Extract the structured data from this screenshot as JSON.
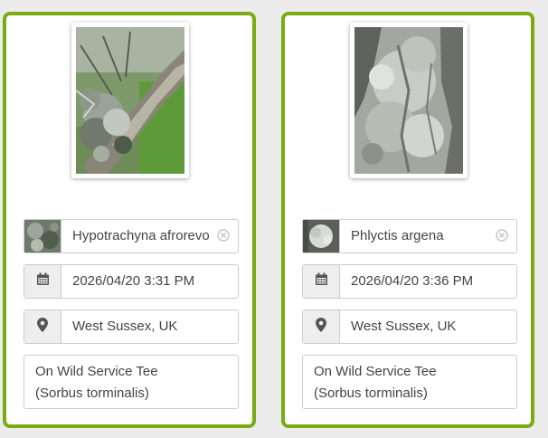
{
  "colors": {
    "card_border": "#7aab12",
    "page_background": "#ececec",
    "field_border": "#cccccc",
    "addon_background": "#eeeeee"
  },
  "observations": [
    {
      "species": "Hypotrachyna afrorevo",
      "datetime": "2026/04/20 3:31 PM",
      "location": "West Sussex, UK",
      "notes": "On Wild Service Tee\n(Sorbus torminalis)",
      "icons": {
        "datetime": "calendar-icon",
        "location": "map-marker-icon",
        "clear": "clear-circle-x-icon"
      }
    },
    {
      "species": "Phlyctis argena",
      "datetime": "2026/04/20 3:36 PM",
      "location": "West Sussex, UK",
      "notes": "On Wild Service Tee\n(Sorbus torminalis)",
      "icons": {
        "datetime": "calendar-icon",
        "location": "map-marker-icon",
        "clear": "clear-circle-x-icon"
      }
    }
  ]
}
